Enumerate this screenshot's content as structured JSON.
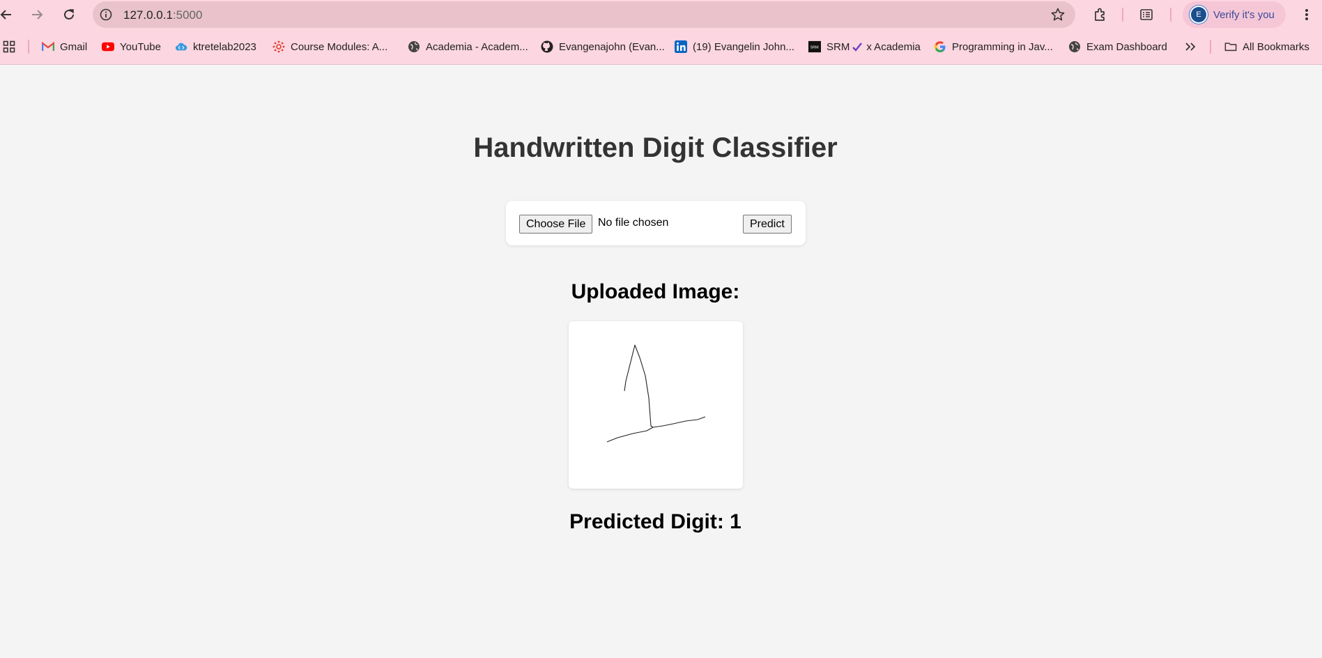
{
  "browser": {
    "url_host": "127.0.0.1",
    "url_port": ":5000",
    "verify_label": "Verify it's you",
    "profile_initial": "E"
  },
  "bookmarks": {
    "items": [
      {
        "label": "Gmail",
        "icon": "gmail-icon"
      },
      {
        "label": "YouTube",
        "icon": "youtube-icon"
      },
      {
        "label": "ktretelab2023",
        "icon": "cloud-code-icon"
      },
      {
        "label": "Course Modules: A...",
        "icon": "canvas-icon"
      },
      {
        "label": "Academia - Academ...",
        "icon": "globe-icon"
      },
      {
        "label": "Evangenajohn (Evan...",
        "icon": "github-icon"
      },
      {
        "label": "(19) Evangelin John...",
        "icon": "linkedin-icon"
      },
      {
        "label": "SRM",
        "label2": "x Academia",
        "icon": "srm-icon"
      },
      {
        "label": "Programming in Jav...",
        "icon": "google-icon"
      },
      {
        "label": "Exam Dashboard",
        "icon": "globe-icon"
      }
    ],
    "all_bookmarks_label": "All Bookmarks"
  },
  "page": {
    "title": "Handwritten Digit Classifier",
    "choose_file_label": "Choose File",
    "file_status": "No file chosen",
    "predict_label": "Predict",
    "uploaded_heading": "Uploaded Image:",
    "prediction_heading": "Predicted Digit: 1"
  },
  "colors": {
    "chrome_bg": "#fcd6e0",
    "omnibox_bg": "#e9c2cc",
    "page_bg": "#f4f4f4",
    "title_color": "#333333"
  }
}
